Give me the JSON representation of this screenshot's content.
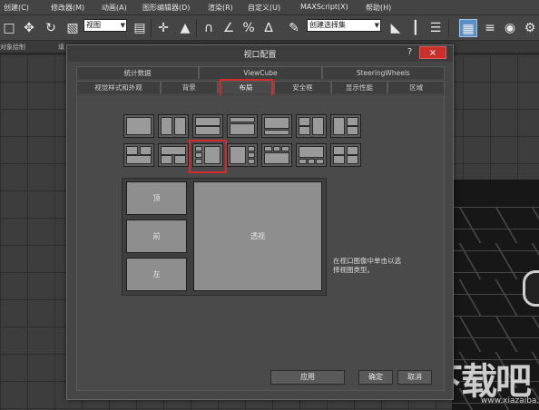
{
  "menu": {
    "items": [
      "创建(C)",
      "修改器(M)",
      "动画(A)",
      "图形编辑器(D)",
      "渲染(R)",
      "自定义(U)",
      "MAXScript(X)",
      "帮助(H)"
    ]
  },
  "toolbar": {
    "view_select": "视图",
    "selection_set_placeholder": "创建选择集",
    "icons": [
      "select-cursor",
      "move",
      "rotate",
      "scale",
      "snap",
      "angle-snap",
      "percent-snap",
      "spinner-snap",
      "mirror",
      "align",
      "layers",
      "curve-editor",
      "schematic",
      "material-editor",
      "render-setup",
      "render"
    ]
  },
  "ribbon": {
    "items": [
      "对象绘制",
      "填"
    ]
  },
  "dialog": {
    "title": "视口配置",
    "help": "?",
    "close": "×",
    "tabs_row1": [
      "统计数据",
      "ViewCube",
      "SteeringWheels"
    ],
    "tabs_row2": [
      "视觉样式和外观",
      "背景",
      "布局",
      "安全框",
      "显示性能",
      "区域"
    ],
    "selected_tab": "布局",
    "preview": {
      "top_label": "顶",
      "front_label": "前",
      "left_label": "左",
      "persp_label": "透视"
    },
    "hint": "在视口图像中单击以选择视图类型。",
    "buttons": {
      "apply": "应用",
      "ok": "确定",
      "cancel": "取消"
    }
  },
  "watermark": {
    "brand": "下载吧",
    "url": "www.xiazaiba.com"
  },
  "colors": {
    "highlight": "#d42b2b",
    "close_button": "#c9302c",
    "active_tool": "#5b8fc6"
  }
}
